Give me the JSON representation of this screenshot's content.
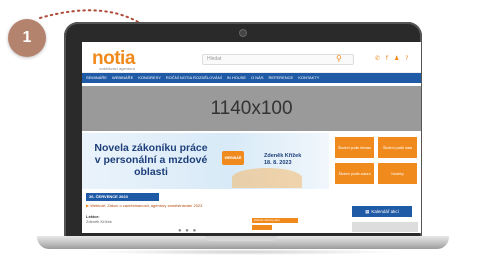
{
  "step": {
    "number": "1"
  },
  "site": {
    "logo": "notia",
    "logo_sub": "vzdělávací agentura",
    "search_placeholder": "Hledat",
    "social_icons": "✆ f ♟ ?",
    "nav": [
      "SEMINÁŘE",
      "WEBINÁŘE",
      "KONGRESY",
      "ROČNÍ NOTIA ROZDĚLOVÁNÍ",
      "IN HOUSE",
      "O NÁS",
      "REFERENCE",
      "KONTAKTY"
    ],
    "banner_placeholder": "1140x100",
    "hero": {
      "title": "Novela zákoníku práce v personální a mzdové oblasti",
      "badge": "WEBINÁŘ",
      "speaker_name": "Zdeněk Křížek",
      "speaker_date": "18. 8. 2023"
    },
    "tiles": [
      "Školení podle tématu",
      "Školení podle data",
      "Školení podle autora",
      "Novinky"
    ],
    "event": {
      "date": "26. ČERVENCE 2023",
      "title": "Webinář: Zákon o zaměstnanosti, agentury zaměstnávání 2023",
      "lektor_label": "Lektor:",
      "lektor_name": "Zdeněk Křížek"
    },
    "calendar_button": "Kalendář akcí",
    "mini_tag": "Zobrazit všechny akce"
  }
}
